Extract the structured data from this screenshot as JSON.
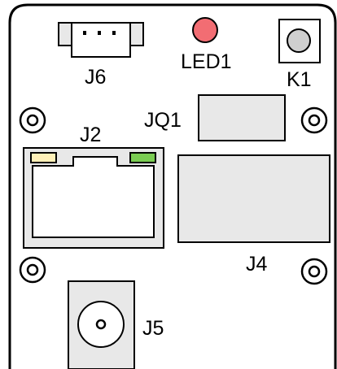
{
  "board": {
    "labels": {
      "j6": "J6",
      "led1": "LED1",
      "k1": "K1",
      "jq1": "JQ1",
      "j2": "J2",
      "j4": "J4",
      "j5": "J5"
    },
    "colors": {
      "outline": "#000000",
      "led": "#f26d73",
      "button": "#cfcfcf",
      "component_fill": "#e8e8e8",
      "jack_fill": "#ffffff",
      "led_green": "#7acc52",
      "led_yellow": "#fff0b8"
    },
    "icons": {
      "mounting_hole": "mounting-hole-icon",
      "led": "led-icon",
      "button": "push-button-icon"
    }
  }
}
